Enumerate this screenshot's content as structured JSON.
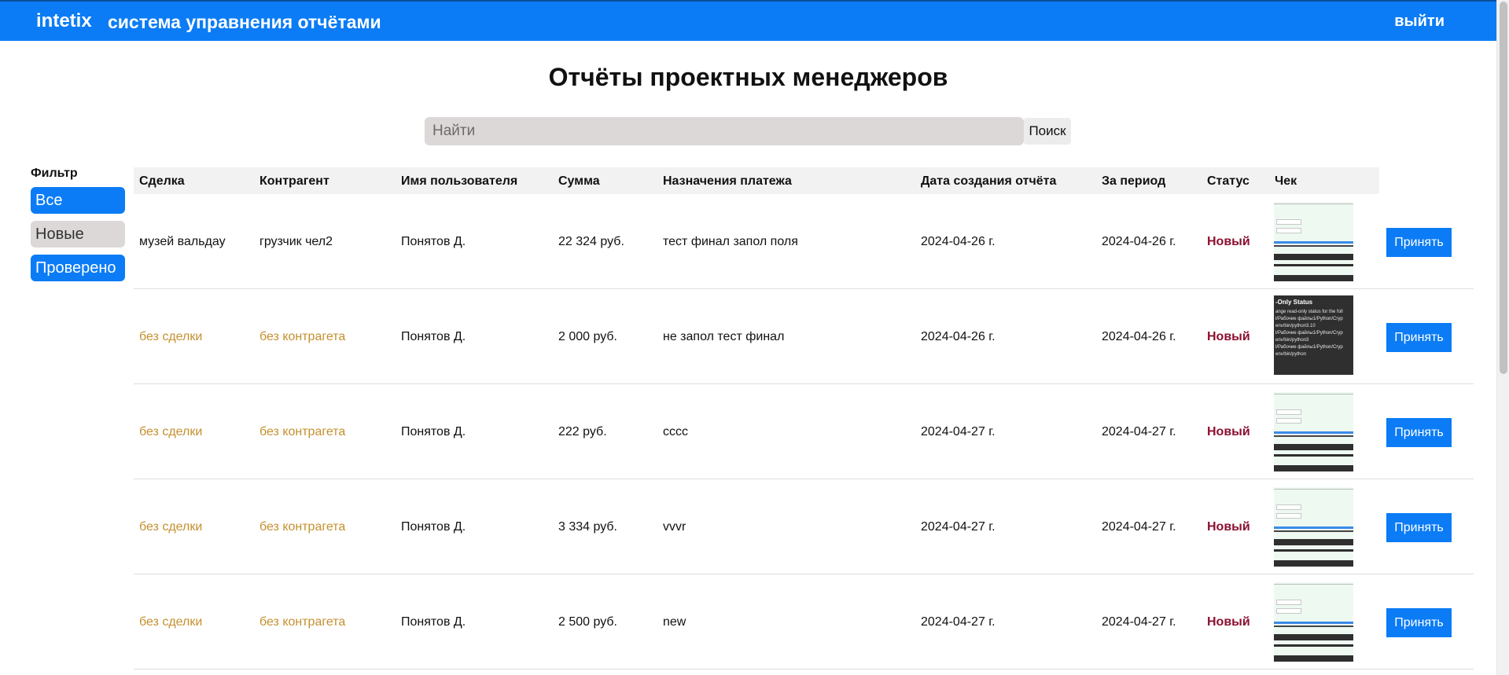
{
  "header": {
    "brand": "intetix",
    "title": "система управнения отчётами",
    "logout": "выйти"
  },
  "page": {
    "title": "Отчёты проектных менеджеров"
  },
  "search": {
    "placeholder": "Найти",
    "button": "Поиск"
  },
  "filter": {
    "title": "Фильтр",
    "options": [
      {
        "label": "Все",
        "active": true
      },
      {
        "label": "Новые",
        "active": false
      },
      {
        "label": "Проверено",
        "active": true
      }
    ]
  },
  "table": {
    "columns": [
      "Сделка",
      "Контрагент",
      "Имя пользователя",
      "Сумма",
      "Назначения платежа",
      "Дата создания отчёта",
      "За период",
      "Статус",
      "Чек"
    ],
    "accept_label": "Принять",
    "rows": [
      {
        "deal": "музей вальдау",
        "counterparty": "грузчик чел2",
        "user": "Понятов Д.",
        "amount": "22 324 руб.",
        "purpose": "тест финал запол поля",
        "created": "2024-04-26 г.",
        "period": "2024-04-26 г.",
        "status": "Новый",
        "receipt": "light"
      },
      {
        "deal": "без сделки",
        "counterparty": "без контрагета",
        "user": "Понятов Д.",
        "amount": "2 000 руб.",
        "purpose": "не запол тест финал",
        "created": "2024-04-26 г.",
        "period": "2024-04-26 г.",
        "status": "Новый",
        "receipt": "dark"
      },
      {
        "deal": "без сделки",
        "counterparty": "без контрагета",
        "user": "Понятов Д.",
        "amount": "222 руб.",
        "purpose": "сссс",
        "created": "2024-04-27 г.",
        "period": "2024-04-27 г.",
        "status": "Новый",
        "receipt": "light"
      },
      {
        "deal": "без сделки",
        "counterparty": "без контрагета",
        "user": "Понятов Д.",
        "amount": "3 334 руб.",
        "purpose": "vvvr",
        "created": "2024-04-27 г.",
        "period": "2024-04-27 г.",
        "status": "Новый",
        "receipt": "light"
      },
      {
        "deal": "без сделки",
        "counterparty": "без контрагета",
        "user": "Понятов Д.",
        "amount": "2 500 руб.",
        "purpose": "new",
        "created": "2024-04-27 г.",
        "period": "2024-04-27 г.",
        "status": "Новый",
        "receipt": "light"
      }
    ]
  },
  "receipt_dark": {
    "heading": "-Only Status",
    "lines": [
      "ange read-only status for the foll",
      "l/Рабочие файлы1/Python/Cryp",
      "env/bin/python3.10",
      "l/Рабочие файлы1/Python/Cryp",
      "env/bin/python3",
      "l/Рабочие файлы1/Python/Cryp",
      "env/bin/python"
    ]
  },
  "colors": {
    "header_bg": "#0b7cf5",
    "accent": "#0b7cf5",
    "status_new": "#8c1030",
    "placeholder_text": "#c5902f"
  }
}
